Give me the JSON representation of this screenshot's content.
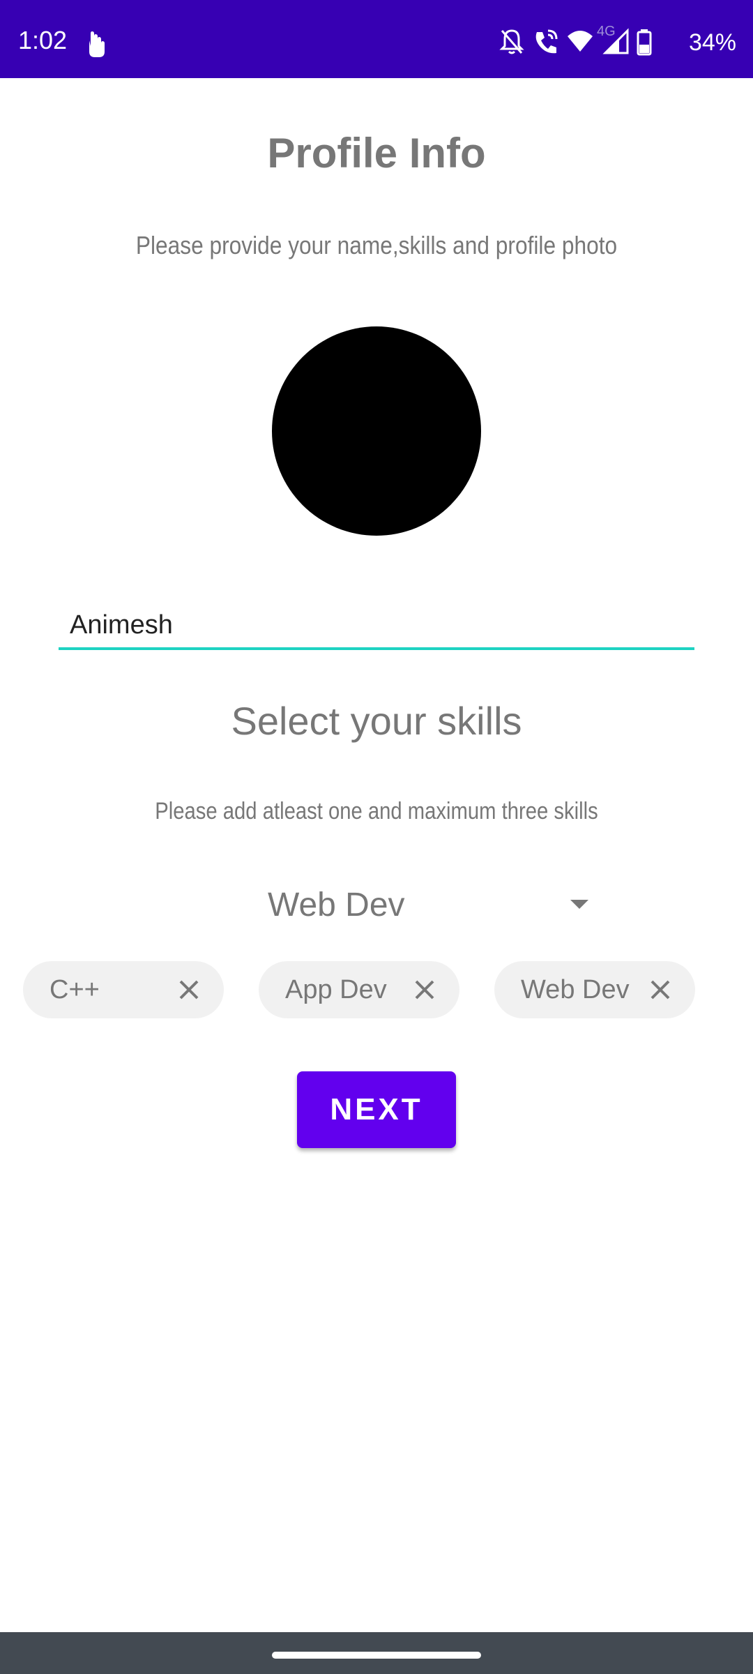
{
  "status_bar": {
    "time": "1:02",
    "network_label": "4G",
    "battery": "34%",
    "icons": [
      "touch-hand-icon",
      "bell-off-icon",
      "wifi-call-icon",
      "wifi-icon",
      "signal-icon",
      "battery-icon"
    ]
  },
  "header": {
    "title": "Profile Info",
    "subtitle": "Please provide your name,skills and profile photo"
  },
  "profile": {
    "name_value": "Animesh"
  },
  "skills": {
    "title": "Select your skills",
    "subtitle": "Please add atleast one and maximum three skills",
    "dropdown_selected": "Web Dev",
    "chips": [
      {
        "label": "C++"
      },
      {
        "label": "App Dev"
      },
      {
        "label": "Web Dev"
      }
    ]
  },
  "actions": {
    "next_label": "NEXT"
  },
  "colors": {
    "status_bar": "#3700b3",
    "accent": "#6200ee",
    "field_underline": "#1ed3c2",
    "nav_bar": "#434a52"
  }
}
